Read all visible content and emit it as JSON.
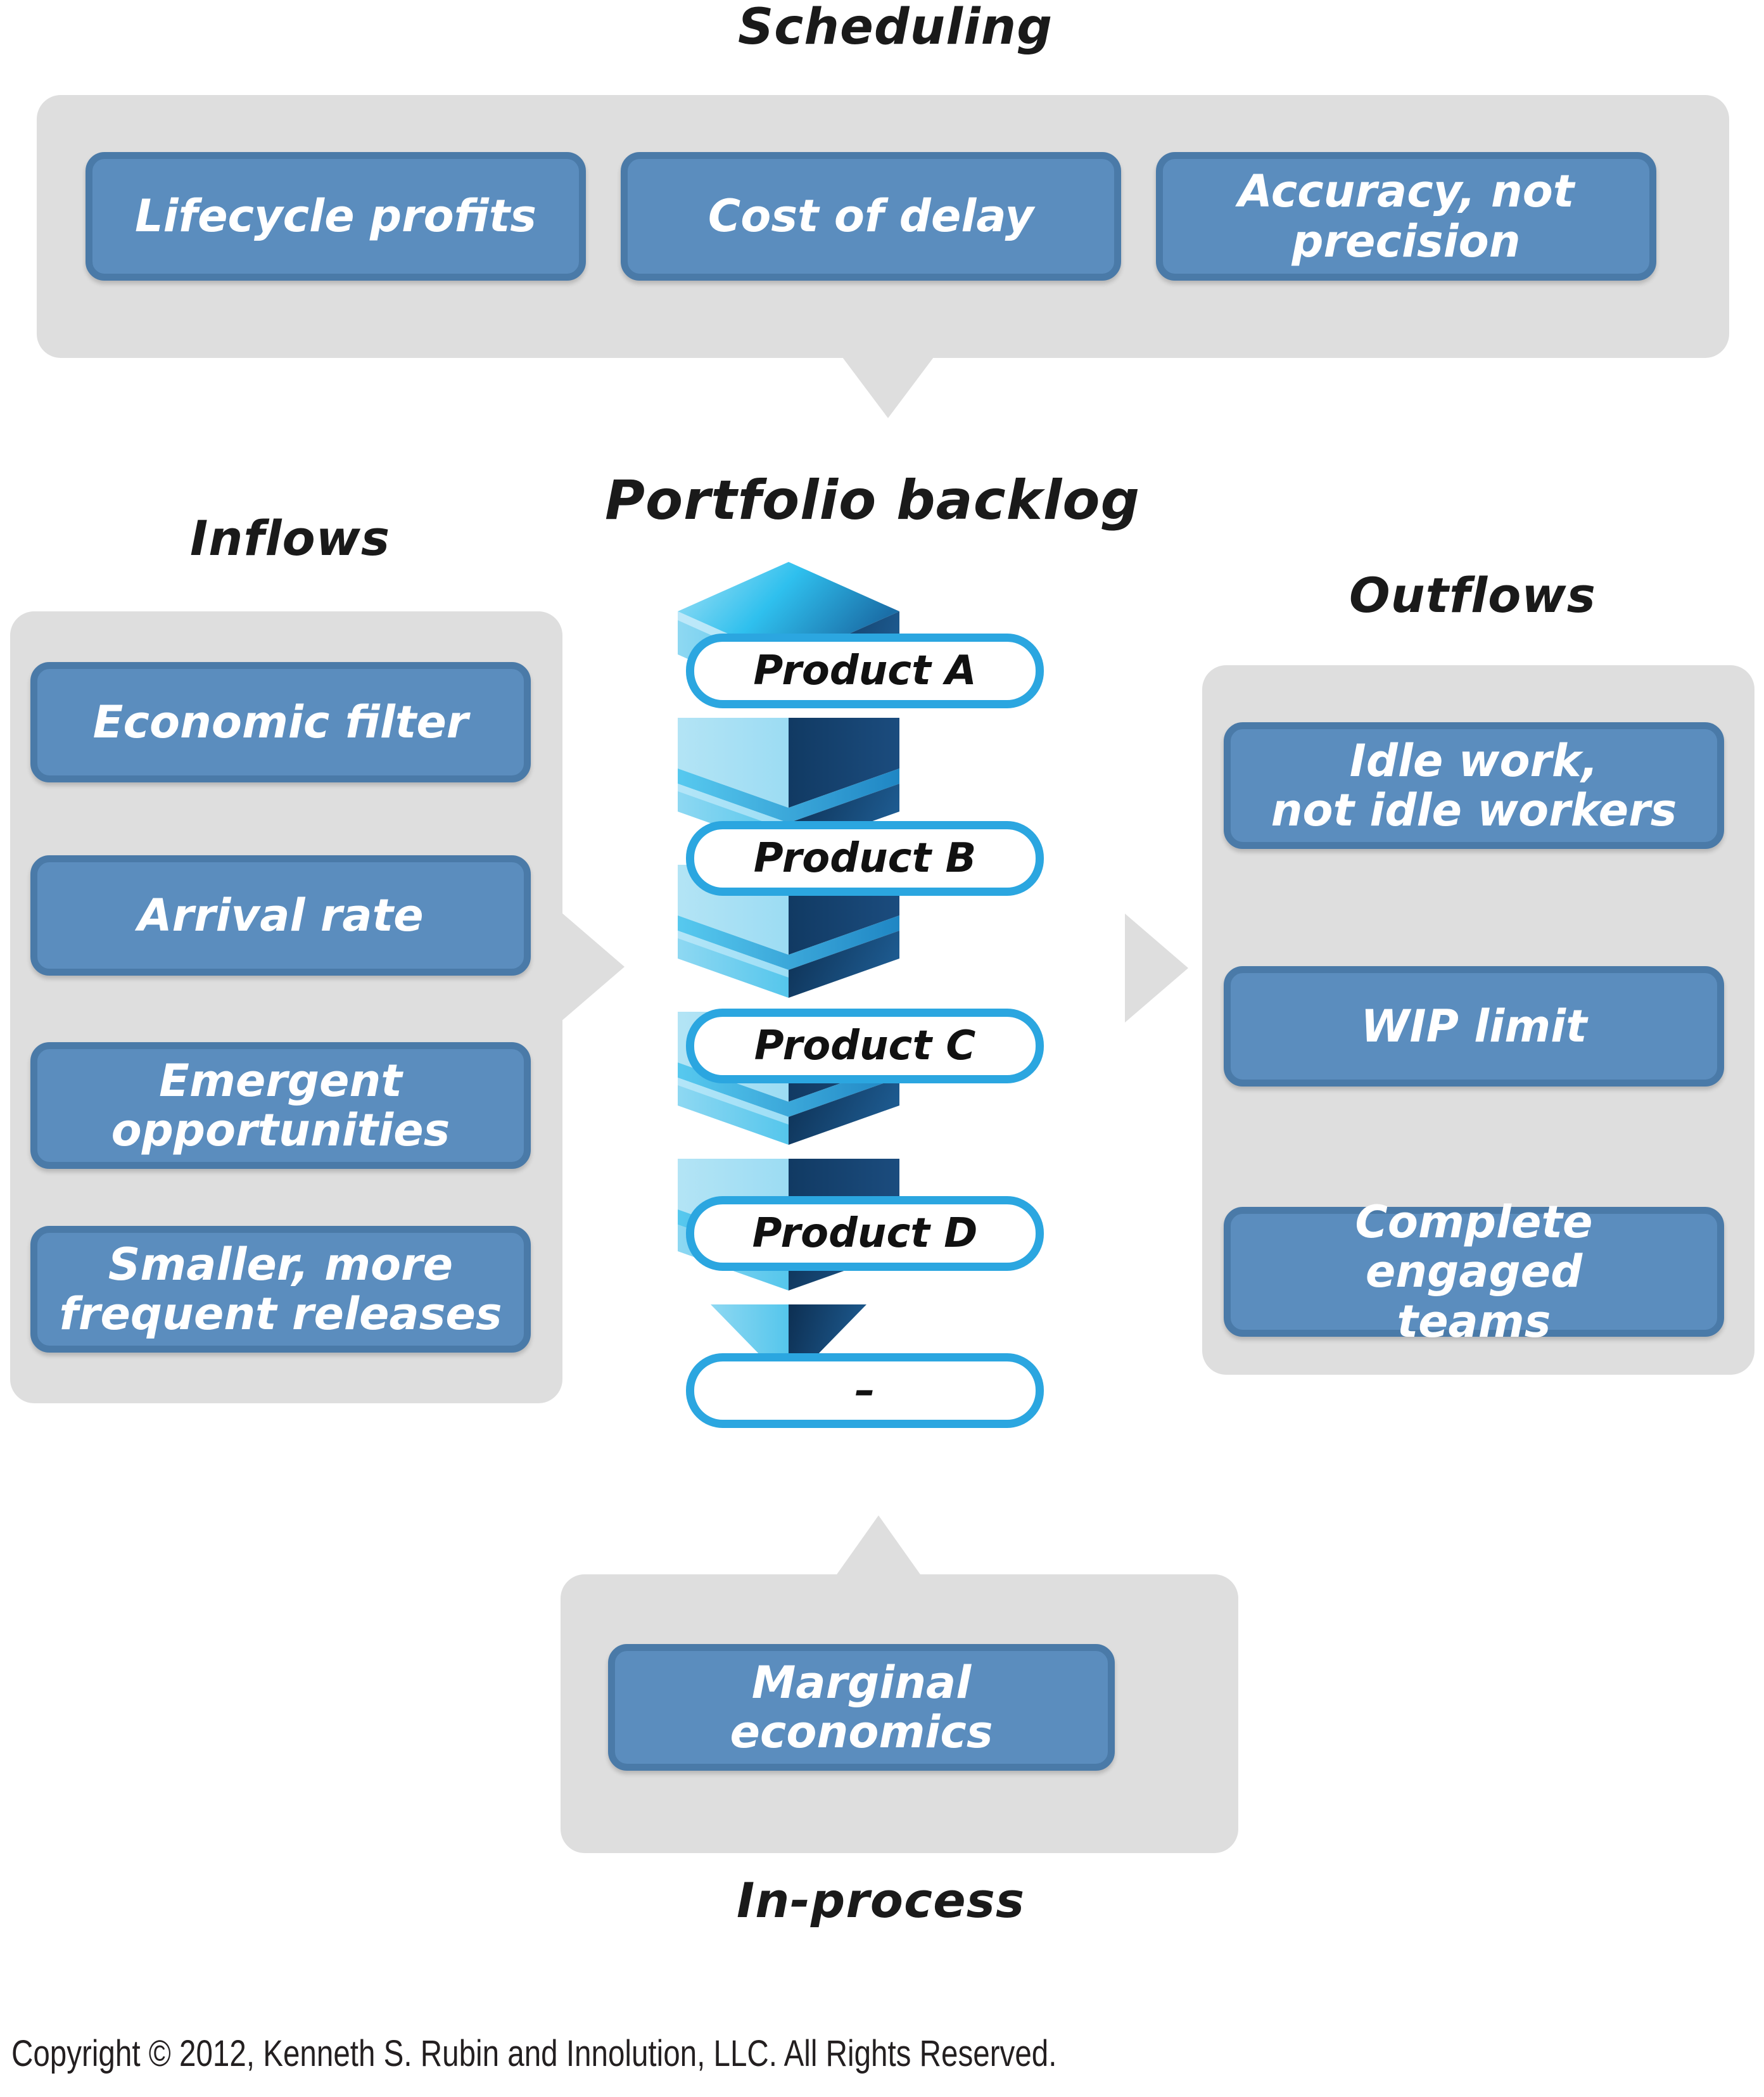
{
  "sections": {
    "scheduling": {
      "caption": "Scheduling",
      "items": [
        {
          "label": "Lifecycle profits"
        },
        {
          "label": "Cost of delay"
        },
        {
          "label": "Accuracy, not\nprecision"
        }
      ]
    },
    "inflows": {
      "caption": "Inflows",
      "items": [
        {
          "label": "Economic filter"
        },
        {
          "label": "Arrival rate"
        },
        {
          "label": "Emergent\nopportunities"
        },
        {
          "label": "Smaller, more\nfrequent releases"
        }
      ]
    },
    "outflows": {
      "caption": "Outflows",
      "items": [
        {
          "label": "Idle work,\nnot idle workers"
        },
        {
          "label": "WIP limit"
        },
        {
          "label": "Complete engaged\nteams"
        }
      ]
    },
    "in_process": {
      "caption": "In-process",
      "items": [
        {
          "label": "Marginal economics"
        }
      ]
    }
  },
  "backlog": {
    "title": "Portfolio backlog",
    "items": [
      {
        "label": "Product A"
      },
      {
        "label": "Product B"
      },
      {
        "label": "Product C"
      },
      {
        "label": "Product D"
      },
      {
        "label": "–"
      }
    ]
  },
  "footer": {
    "copyright": "Copyright © 2012, Kenneth S. Rubin and Innolution, LLC. All Rights Reserved."
  },
  "colors": {
    "panel_gray": "#DEDEDE",
    "button_fill": "#5B8DBE",
    "button_border": "#4A7AA8",
    "pill_border": "#2BA6E0",
    "stack_light": "#7FD3F0",
    "stack_mid": "#2BB3E8",
    "stack_dark": "#1A3E६6",
    "text_dark": "#1A1A1A",
    "text_light": "#FFFFFF"
  }
}
